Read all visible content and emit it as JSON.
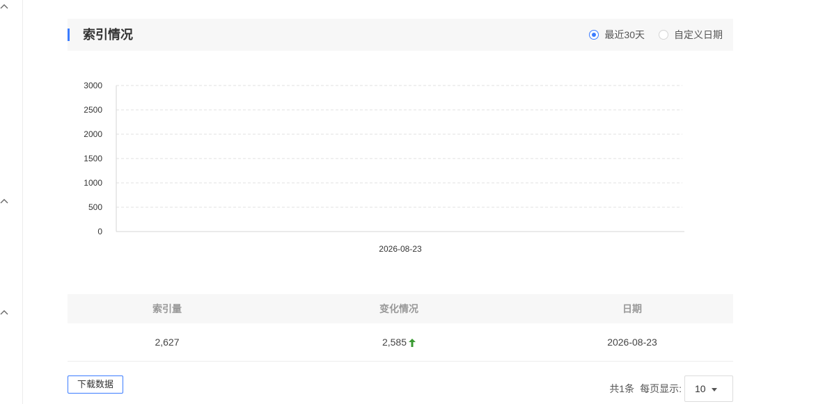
{
  "section": {
    "title": "索引情况",
    "range_options": [
      {
        "label": "最近30天",
        "checked": true
      },
      {
        "label": "自定义日期",
        "checked": false
      }
    ]
  },
  "chart_data": {
    "type": "line",
    "title": "",
    "xlabel": "",
    "ylabel": "",
    "x": [
      "2026-08-23"
    ],
    "y_ticks": [
      "3000",
      "2500",
      "2000",
      "1500",
      "1000",
      "500",
      "0"
    ],
    "ylim": [
      0,
      3000
    ],
    "grid": true,
    "series": [
      {
        "name": "",
        "values": []
      }
    ]
  },
  "table": {
    "headers": [
      "索引量",
      "变化情况",
      "日期"
    ],
    "rows": [
      {
        "index_count": "2,627",
        "change": "2,585",
        "date": "2026-08-23",
        "trend": "up"
      }
    ]
  },
  "footer": {
    "download_label": "下载数据",
    "total_text": "共1条",
    "per_page_label": "每页显示:",
    "page_size": "10"
  },
  "colors": {
    "accent": "#3b7cff",
    "up": "#3a9a32",
    "grid": "#e2e2e2"
  }
}
